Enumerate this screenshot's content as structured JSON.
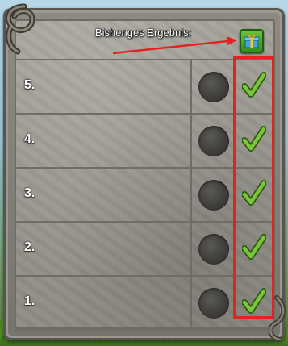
{
  "header": {
    "label": "Bisheriges Ergebnis:",
    "result_icon": "gift-box-icon"
  },
  "rows": [
    {
      "label": "5.",
      "slot": "empty",
      "status_icon": "checkmark-icon"
    },
    {
      "label": "4.",
      "slot": "empty",
      "status_icon": "checkmark-icon"
    },
    {
      "label": "3.",
      "slot": "empty",
      "status_icon": "checkmark-icon"
    },
    {
      "label": "2.",
      "slot": "empty",
      "status_icon": "checkmark-icon"
    },
    {
      "label": "1.",
      "slot": "empty",
      "status_icon": "checkmark-icon"
    }
  ],
  "colors": {
    "annotation_red": "#e0241f",
    "check_green": "#7cc43a",
    "button_green": "#2f8a1a"
  }
}
